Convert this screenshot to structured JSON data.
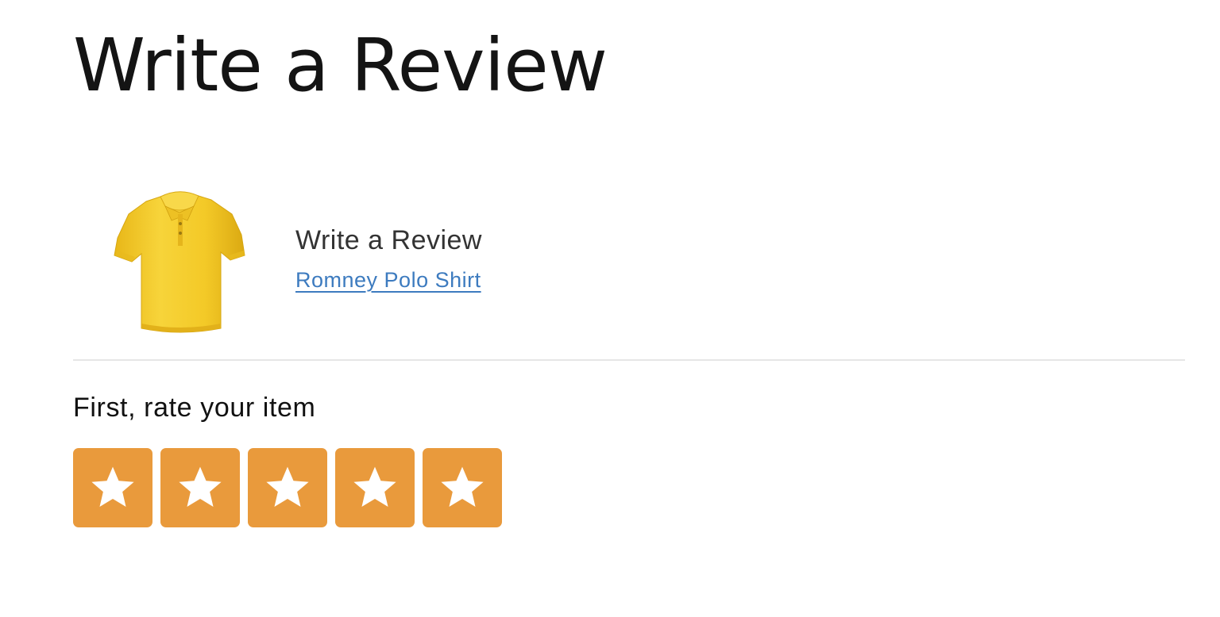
{
  "page": {
    "title": "Write a Review"
  },
  "product": {
    "heading": "Write a Review",
    "name": "Romney Polo Shirt",
    "image_icon": "yellow-polo-shirt",
    "image_color": "#f4c92a"
  },
  "rating": {
    "prompt": "First, rate your item",
    "max_stars": 5,
    "star_icon": "star-icon",
    "button_color": "#e99a3c",
    "star_color": "#ffffff"
  },
  "colors": {
    "link": "#3d7bbf",
    "divider": "#e6e6e6"
  }
}
